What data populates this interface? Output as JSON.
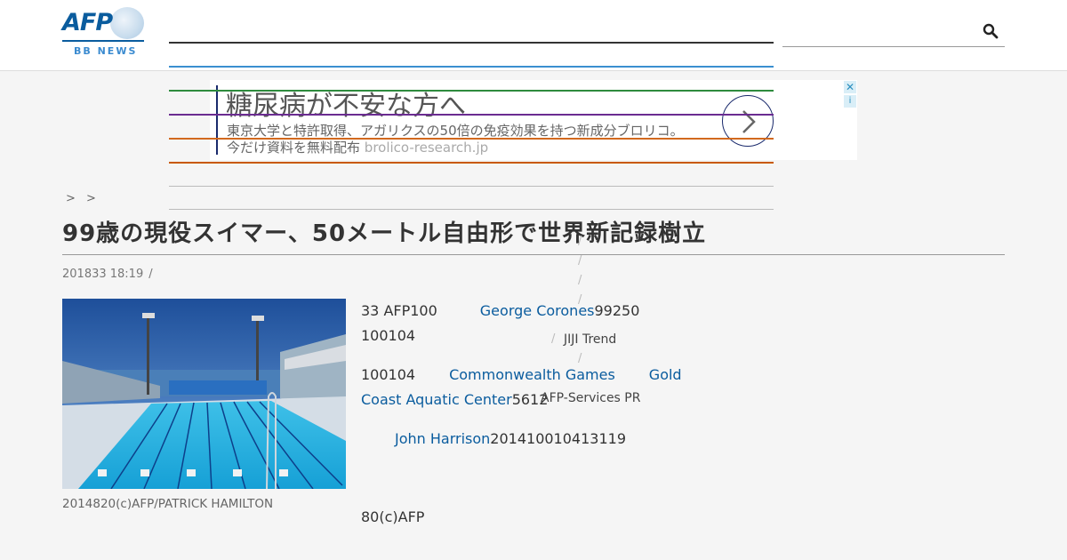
{
  "logo": {
    "afp": "AFP",
    "sub": "BB NEWS"
  },
  "colors": {
    "link": "#0a5c9e",
    "logo_blue": "#0a5c9e",
    "ad_border": "#1a2a6c"
  },
  "ad": {
    "title": "糖尿病が不安な方へ",
    "desc": "東京大学と特許取得、アガリクスの50倍の免疫効果を持つ新成分ブロリコ。",
    "desc2": "今だけ資料を無料配布",
    "domain": "brolico-research.jp",
    "close": "✕",
    "info": "i"
  },
  "breadcrumb": "> >",
  "article": {
    "title": "99歳の現役スイマー、50メートル自由形で世界新記録樹立",
    "date": "201833 18:19",
    "meta_sep": "/",
    "caption": "2014820(c)AFP/PATRICK HAMILTON",
    "p1_a": "33 AFP100",
    "p1_link": "George Corones",
    "p1_b": "99250",
    "p1_line2": "100104",
    "p2_a": "100104",
    "p2_link1": "Commonwealth Games",
    "p2_link2": "Gold",
    "p2_link2b": "Coast Aquatic Center",
    "p2_b": "5612",
    "p3_link": "John Harrison",
    "p3_b": "201410010413119",
    "p4": "80(c)AFP"
  },
  "sidebar": {
    "slash": "/",
    "jiji": "JIJI Trend",
    "afp_services": "AFP-Services PR"
  }
}
